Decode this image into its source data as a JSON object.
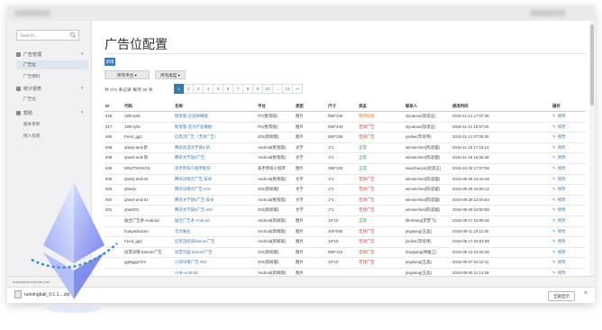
{
  "search": {
    "placeholder": "Search..."
  },
  "sidebar": {
    "groups": [
      {
        "label": "广告管理",
        "items": [
          "广告位",
          "广告物料"
        ]
      },
      {
        "label": "统计报表",
        "items": [
          "广告位"
        ]
      },
      {
        "label": "帮助",
        "items": [
          "版本更新",
          "接入指南"
        ]
      }
    ]
  },
  "page": {
    "title": "广告位配置",
    "new_button": "新增",
    "filter_platform": "所有平台 ▾",
    "filter_type": "所有类型 ▾",
    "summary": "共 371 条记录 每页 30 条"
  },
  "pager": [
    "1",
    "2",
    "3",
    "4",
    "5",
    "6",
    "7",
    "8",
    "9",
    "10",
    "...",
    "13",
    "»»"
  ],
  "table": {
    "headers": [
      "ID",
      "代码",
      "名称",
      "平台",
      "类型",
      "尺寸",
      "状态",
      "联系人",
      "修改时间",
      "操作"
    ],
    "edit_label": "修改",
    "rows": [
      {
        "id": "518",
        "code": "JZB-splic",
        "name": "框架版-启动屏横幅",
        "platform": "PC(框架版)",
        "type": "图片",
        "size": "555*440",
        "status": "暂停投放",
        "status_class": "orange",
        "contact": "siyuanxu(徐思远)",
        "time": "2016-11-21 17:07:28"
      },
      {
        "id": "517",
        "code": "JZB-sylic",
        "name": "框架版-首页产品横幅",
        "platform": "PC(框架版)",
        "type": "图片",
        "size": "555*440",
        "status": "无效广告",
        "status_class": "red",
        "contact": "siyuanxu(徐思远)",
        "time": "2016-11-21 16:57:26"
      },
      {
        "id": "465",
        "code": "Feed_gg1",
        "name": "信息流广告（无效广告）",
        "platform": "iOS(新闻版)",
        "type": "图片",
        "size": "690*155",
        "status": "无效广告",
        "status_class": "red",
        "contact": "jovilee(李培伟)",
        "time": "2016-11-21 07:09:25"
      },
      {
        "id": "509",
        "code": "qhwzj-and-新",
        "name": "腾讯优选文字链5-新",
        "platform": "Android(框架版)",
        "type": "文字",
        "size": "1*1",
        "status": "正常",
        "status_class": "green",
        "contact": "winniechen(陈思璇)",
        "time": "2016-11-18 17:16:14"
      },
      {
        "id": "508",
        "code": "qhwzt-and-新",
        "name": "腾讯文字链5广告",
        "platform": "Android(框架版)",
        "type": "文字",
        "size": "1*1",
        "status": "正常",
        "status_class": "green",
        "contact": "winniechen(陈思璇)",
        "time": "2016-11-18 16:56:28"
      },
      {
        "id": "506",
        "code": "WNZTWXKCK",
        "name": "高手帮扣小程序推荐",
        "platform": "高手帮扣小程序",
        "type": "图片",
        "size": "355*100",
        "status": "正常",
        "status_class": "green",
        "contact": "xiaozhaoyin(赵思言)",
        "time": "2016-10-18 17:07:06"
      },
      {
        "id": "505",
        "code": "qhwzj-and-02",
        "name": "腾讯详情页广告-安卓",
        "platform": "Android(框架版)",
        "type": "文字",
        "size": "1*1",
        "status": "无效广告",
        "status_class": "red",
        "contact": "winniechen(陈思璇)",
        "time": "2016-09-29 16:15:48"
      },
      {
        "id": "503",
        "code": "qhwzjx",
        "name": "腾讯详情页广告-iOS",
        "platform": "iOS(新闻版)",
        "type": "文字",
        "size": "1*1",
        "status": "无效广告",
        "status_class": "red",
        "contact": "winniechen(陈思璇)",
        "time": "2016-09-29 16:09:12"
      },
      {
        "id": "502",
        "code": "qhwzt-and-01",
        "name": "腾讯文字链5广告-安卓",
        "platform": "Android(框架版)",
        "type": "文字",
        "size": "1*1",
        "status": "无效广告",
        "status_class": "red",
        "contact": "winniechen(陈思璇)",
        "time": "2016-09-29 16:04:52"
      },
      {
        "id": "501",
        "code": "qhwzt01",
        "name": "腾讯文字链5广告-iOS",
        "platform": "iOS(新闻版)",
        "type": "文字",
        "size": "1*1",
        "status": "无效广告",
        "status_class": "red",
        "contact": "winniechen(陈思璇)",
        "time": "2016-09-29 16:00:58"
      },
      {
        "id": "",
        "code": "励合广告条-Android",
        "name": "励合广告条-Android",
        "platform": "Android(新闻版)",
        "type": "图片",
        "size": "10*10",
        "status": "正常",
        "status_class": "green",
        "contact": "lifenhang(李梦飞)",
        "time": "2016-09-17 16:05:46"
      },
      {
        "id": "",
        "code": "huayanlianxin",
        "name": "华为展业",
        "platform": "Android(新闻版)",
        "type": "图片",
        "size": "400*555",
        "status": "无效广告",
        "status_class": "red",
        "contact": "jingwang(王晶)",
        "time": "2016-09-11 10:11:00"
      },
      {
        "id": "",
        "code": "Feed_gg2",
        "name": "信息流底部banner广告",
        "platform": "Android(新闻版)",
        "type": "图片",
        "size": "10*10",
        "status": "无效广告",
        "status_class": "red",
        "contact": "jovilee(李培伟)",
        "time": "2016-09-17 20:22:09"
      },
      {
        "id": "",
        "code": "投票详情-banner广告",
        "name": "投票页面-banner广告",
        "platform": "iOS(新闻版)",
        "type": "图片",
        "size": "690*110",
        "status": "无效广告",
        "status_class": "red",
        "contact": "linyajiang(林雅江)",
        "time": "2016-09-13 16:04:36"
      },
      {
        "id": "",
        "code": "gglwjggl-iOs",
        "name": "小部详情广告-iOS",
        "platform": "iOS(新闻版)",
        "type": "图片",
        "size": "10*10",
        "status": "无效广告",
        "status_class": "red",
        "contact": "jingwang(王晶)",
        "time": "2016-09-07 10:12:11"
      },
      {
        "id": "",
        "code": "",
        "name": "小米-Android",
        "platform": "Android(新闻版)",
        "type": "图片",
        "size": "",
        "status": "",
        "status_class": "red",
        "contact": "jingwang(王晶)",
        "time": "2016-09-05 11:14:38"
      }
    ]
  },
  "statusbar": {
    "url": "adsupbricproducts.com"
  },
  "download": {
    "file": "runningball_0.1.1....zip",
    "show_all": "全部显示"
  },
  "colors": {
    "primary": "#337ab7",
    "green": "#2e9a2e",
    "red": "#d9362b",
    "orange": "#e07b1a"
  }
}
